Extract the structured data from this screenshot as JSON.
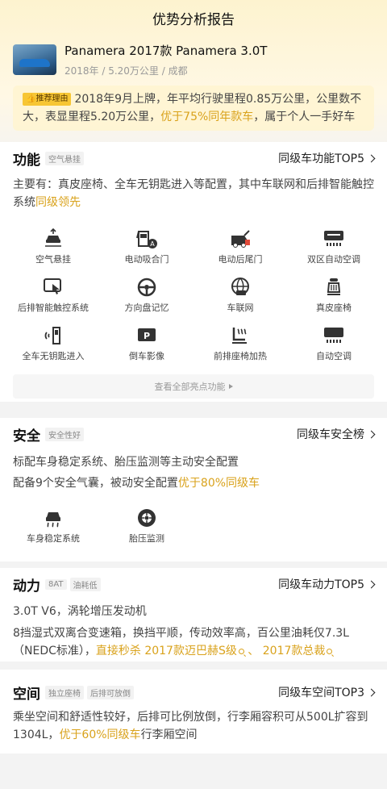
{
  "page_title": "优势分析报告",
  "car": {
    "title": "Panamera 2017款 Panamera 3.0T",
    "subtitle": "2018年 / 5.20万公里 / 成都"
  },
  "reason": {
    "tag": "推荐理由",
    "text_before": "2018年9月上牌，年平均行驶里程0.85万公里，公里数不大，表显里程5.20万公里，",
    "highlight": "优于75%同年款车",
    "text_after": "，属于个人一手好车"
  },
  "function": {
    "title": "功能",
    "chip": "空气悬挂",
    "link": "同级车功能TOP5",
    "summary_before": "主要有：真皮座椅、全车无钥匙进入等配置，其中车联网和后排智能触控系统",
    "summary_highlight": "同级领先",
    "features": [
      {
        "label": "空气悬挂",
        "icon": "air-suspension-icon"
      },
      {
        "label": "电动吸合门",
        "icon": "soft-close-door-icon"
      },
      {
        "label": "电动后尾门",
        "icon": "power-tailgate-icon"
      },
      {
        "label": "双区自动空调",
        "icon": "dual-zone-ac-icon"
      },
      {
        "label": "后排智能触控系统",
        "icon": "rear-touch-icon"
      },
      {
        "label": "方向盘记忆",
        "icon": "steering-memory-icon"
      },
      {
        "label": "车联网",
        "icon": "connected-car-icon"
      },
      {
        "label": "真皮座椅",
        "icon": "leather-seat-icon"
      },
      {
        "label": "全车无钥匙进入",
        "icon": "keyless-entry-icon"
      },
      {
        "label": "倒车影像",
        "icon": "rear-camera-icon"
      },
      {
        "label": "前排座椅加热",
        "icon": "seat-heating-icon"
      },
      {
        "label": "自动空调",
        "icon": "auto-ac-icon"
      }
    ],
    "view_all": "查看全部亮点功能"
  },
  "safety": {
    "title": "安全",
    "chip": "安全性好",
    "link": "同级车安全榜",
    "line1": "标配车身稳定系统、胎压监测等主动安全配置",
    "line2_before": "配备9个安全气囊，被动安全配置",
    "line2_highlight": "优于80%同级车",
    "features": [
      {
        "label": "车身稳定系统",
        "icon": "stability-control-icon"
      },
      {
        "label": "胎压监测",
        "icon": "tire-pressure-icon"
      }
    ]
  },
  "power": {
    "title": "动力",
    "chips": [
      "8AT",
      "油耗低"
    ],
    "link": "同级车动力TOP5",
    "line1": "3.0T V6，涡轮增压发动机",
    "line2": "8挡湿式双离合变速箱，换挡平顺，传动效率高，百公里油耗仅7.3L（NEDC标准），",
    "beat_prefix": "直接秒杀 ",
    "beat_1": "2017款迈巴赫S级",
    "separator": " 、 ",
    "beat_2": "2017款总裁"
  },
  "space": {
    "title": "空间",
    "chips": [
      "独立座椅",
      "后排可放倒"
    ],
    "link": "同级车空间TOP3",
    "line_before": "乘坐空间和舒适性较好，后排可比例放倒，行李厢容积可从500L扩容到1304L，",
    "line_highlight": "优于60%同级车",
    "line_after": "行李厢空间"
  },
  "colors": {
    "accent_gold": "#d9a21b",
    "tag_yellow": "#f7c634"
  }
}
